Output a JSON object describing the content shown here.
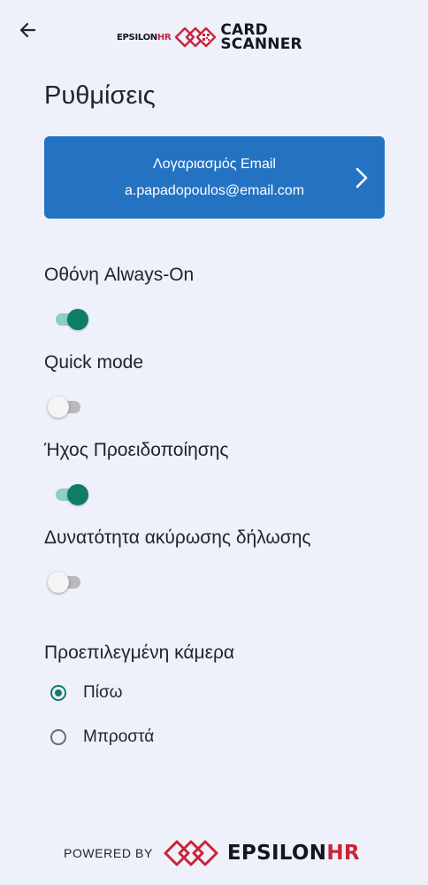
{
  "header": {
    "back_icon": "arrow-left-icon",
    "brand_prefix": "EPSILON",
    "brand_suffix": "HR",
    "product_line1": "CARD",
    "product_line2": "SCANNER"
  },
  "page_title": "Ρυθμίσεις",
  "account": {
    "label": "Λογαριασμός Email",
    "email": "a.papadopoulos@email.com",
    "chevron_icon": "chevron-right-icon"
  },
  "settings": [
    {
      "label": "Οθόνη Always-On",
      "enabled": true
    },
    {
      "label": "Quick mode",
      "enabled": false
    },
    {
      "label": "Ήχος Προειδοποίησης",
      "enabled": true
    },
    {
      "label": "Δυνατότητα ακύρωσης δήλωσης",
      "enabled": false
    }
  ],
  "camera": {
    "label": "Προεπιλεγμένη κάμερα",
    "options": [
      {
        "label": "Πίσω",
        "selected": true
      },
      {
        "label": "Μπροστά",
        "selected": false
      }
    ]
  },
  "footer": {
    "powered_by": "POWERED BY",
    "brand_prefix": "EPSILON",
    "brand_suffix": "HR"
  },
  "colors": {
    "background": "#eef0fa",
    "accent_blue": "#2473c3",
    "toggle_on": "#0f7c6a",
    "brand_red": "#c8243a"
  }
}
